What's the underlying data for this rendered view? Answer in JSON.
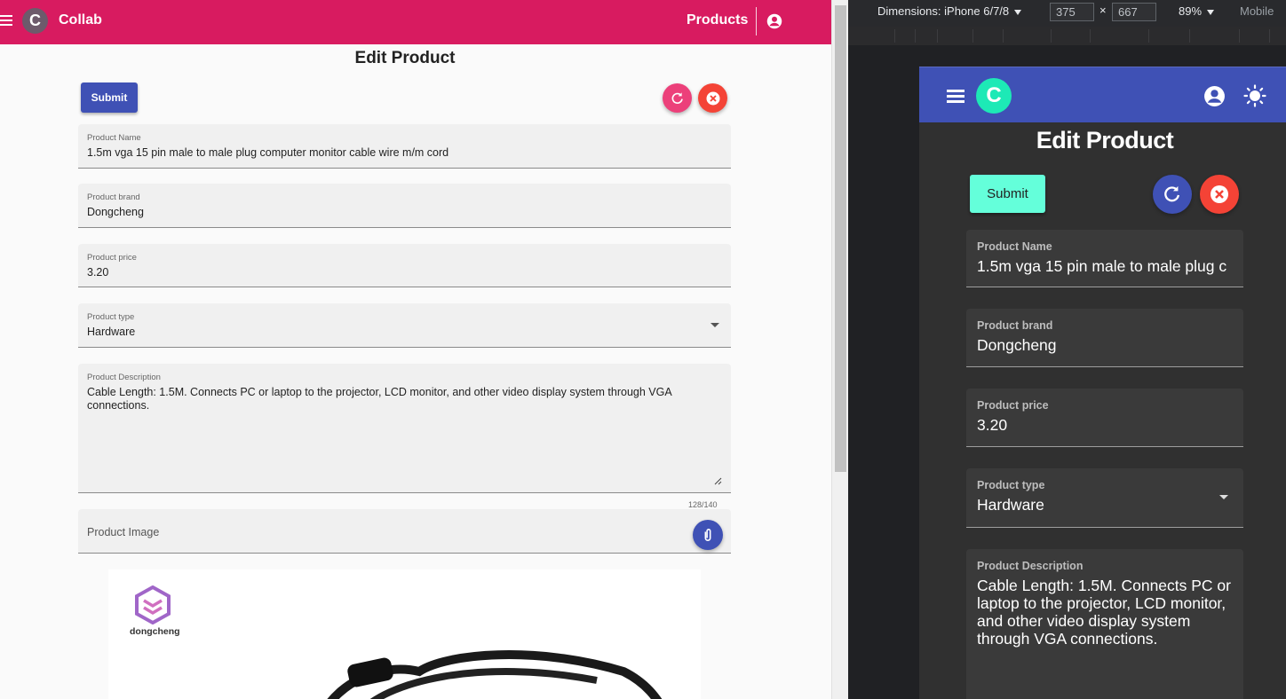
{
  "app": {
    "brand": "Collab",
    "logo_letter": "C",
    "nav_products": "Products",
    "page_title": "Edit Product",
    "submit_label": "Submit"
  },
  "form": {
    "name": {
      "label": "Product Name",
      "value": "1.5m vga 15 pin male to male plug computer monitor cable wire m/m cord"
    },
    "brand": {
      "label": "Product brand",
      "value": "Dongcheng"
    },
    "price": {
      "label": "Product price",
      "value": "3.20"
    },
    "type": {
      "label": "Product type",
      "value": "Hardware"
    },
    "description": {
      "label": "Product Description",
      "value": "Cable Length: 1.5M. Connects PC or laptop to the projector, LCD monitor, and other video display system through VGA connections.",
      "counter": "128/140"
    },
    "image": {
      "placeholder": "Product Image"
    }
  },
  "photo": {
    "brand_text": "dongcheng"
  },
  "mobile": {
    "page_title": "Edit Product",
    "submit_label": "Submit",
    "name_value_visible": "1.5m vga 15 pin male to male plug c",
    "description_lines": [
      "Cable Length: 1.5M. Connects PC or",
      "laptop to the projector, LCD monitor,",
      "and other video display system",
      "through VGA connections."
    ]
  },
  "devtools": {
    "dimensions_label": "Dimensions: iPhone 6/7/8",
    "width": "375",
    "times": "×",
    "height": "667",
    "zoom": "89%",
    "mode": "Mobile"
  },
  "icons": [
    "menu-icon",
    "account-icon",
    "moon-icon",
    "sun-icon",
    "reload-icon",
    "close-icon",
    "attach-icon",
    "dropdown-caret-icon",
    "resize-handle-icon"
  ],
  "colors": {
    "light_primary": "#d81b60",
    "light_submit": "#3f51b5",
    "light_reload": "#ec407a",
    "close": "#f44336",
    "dark_primary": "#3f51b5",
    "dark_accent": "#1de9b6",
    "dark_submit": "#64ffda"
  }
}
